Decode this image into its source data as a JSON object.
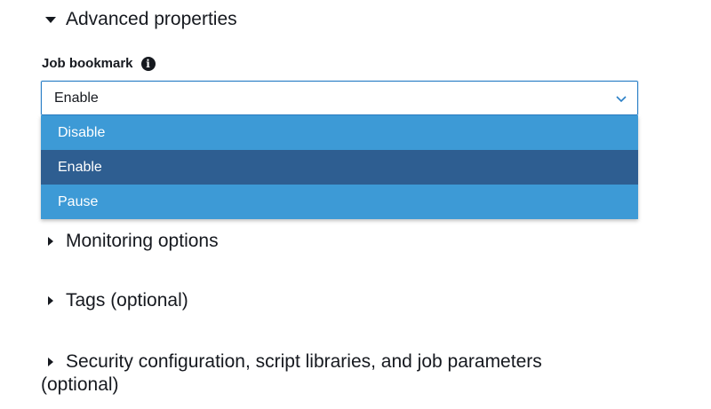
{
  "sections": {
    "advanced": {
      "title": "Advanced properties",
      "expanded": true
    },
    "monitoring": {
      "title": "Monitoring options",
      "expanded": false
    },
    "tags": {
      "title": "Tags (optional)",
      "expanded": false
    },
    "security": {
      "title": "Security configuration, script libraries, and job parameters",
      "title_cont": "(optional)",
      "expanded": false
    }
  },
  "job_bookmark": {
    "label": "Job bookmark",
    "info_icon": "info-icon",
    "selected_value": "Enable",
    "options": [
      {
        "label": "Disable",
        "selected": false
      },
      {
        "label": "Enable",
        "selected": true
      },
      {
        "label": "Pause",
        "selected": false
      }
    ]
  },
  "colors": {
    "option_bg": "#3d9ad6",
    "option_selected_bg": "#2e5e91",
    "select_border": "#2a7fc6"
  }
}
